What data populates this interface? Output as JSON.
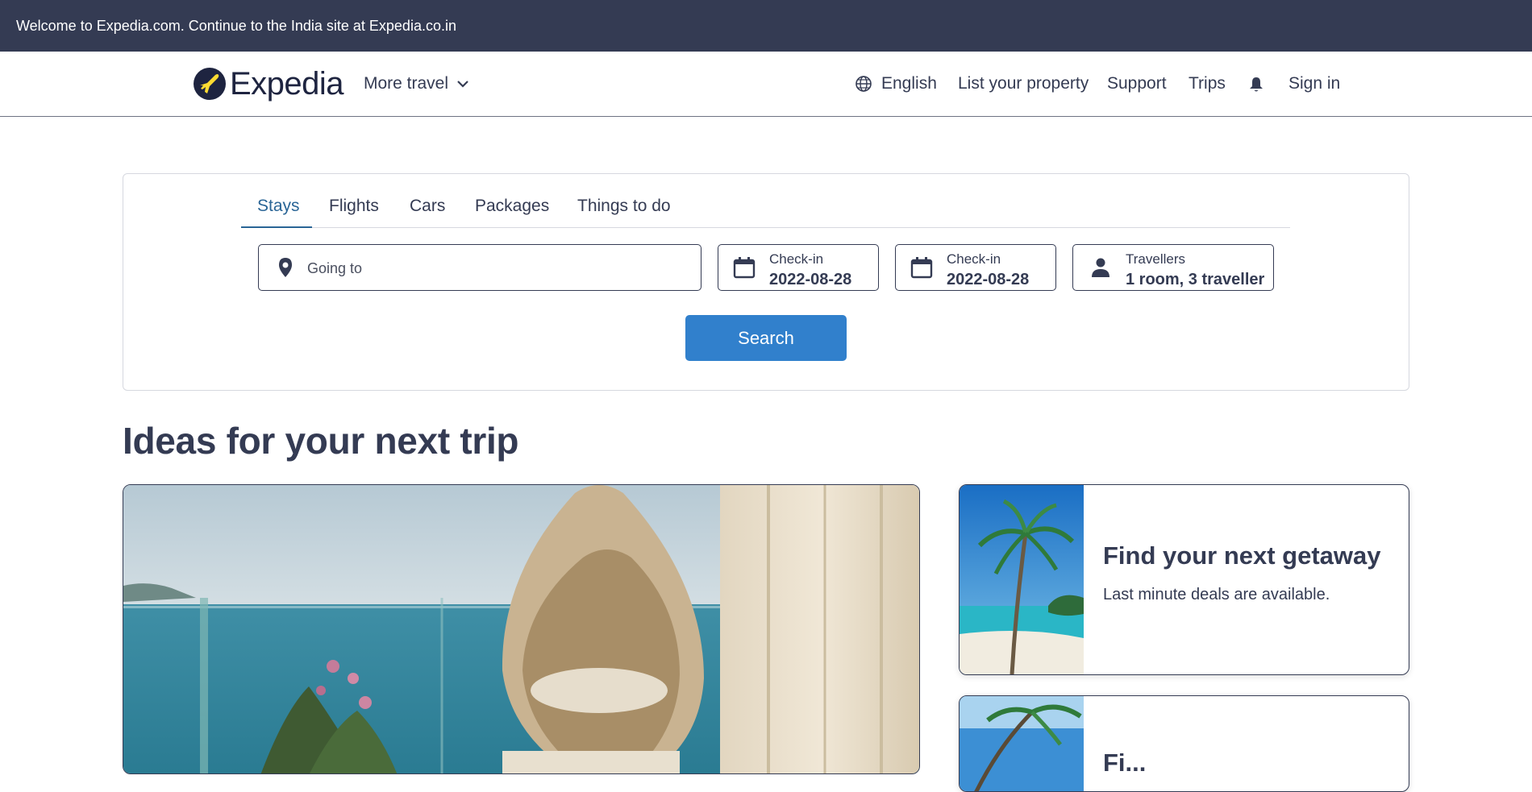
{
  "banner": {
    "text": "Welcome to Expedia.com. Continue to the India site at Expedia.co.in"
  },
  "header": {
    "logo_text": "Expedia",
    "more_travel": "More travel",
    "language": "English",
    "list_property": "List your property",
    "support": "Support",
    "trips": "Trips",
    "sign_in": "Sign in"
  },
  "search": {
    "tabs": [
      "Stays",
      "Flights",
      "Cars",
      "Packages",
      "Things to do"
    ],
    "active_tab": "Stays",
    "going_to_placeholder": "Going to",
    "checkin1_label": "Check-in",
    "checkin1_value": "2022-08-28",
    "checkin2_label": "Check-in",
    "checkin2_value": "2022-08-28",
    "travellers_label": "Travellers",
    "travellers_value": "1 room, 3 traveller",
    "search_button": "Search"
  },
  "ideas": {
    "title": "Ideas for your next trip",
    "promo1_title": "Find your next getaway",
    "promo1_subtitle": "Last minute deals are available.",
    "promo2_title": "Fi..."
  },
  "colors": {
    "banner_bg": "#343b53",
    "text_primary": "#343b53",
    "active_tab": "#2a6596",
    "search_button": "#3180cc"
  },
  "icons": [
    "expedia-logo-icon",
    "chevron-down-icon",
    "globe-icon",
    "bell-icon",
    "location-pin-icon",
    "calendar-icon",
    "person-icon"
  ]
}
